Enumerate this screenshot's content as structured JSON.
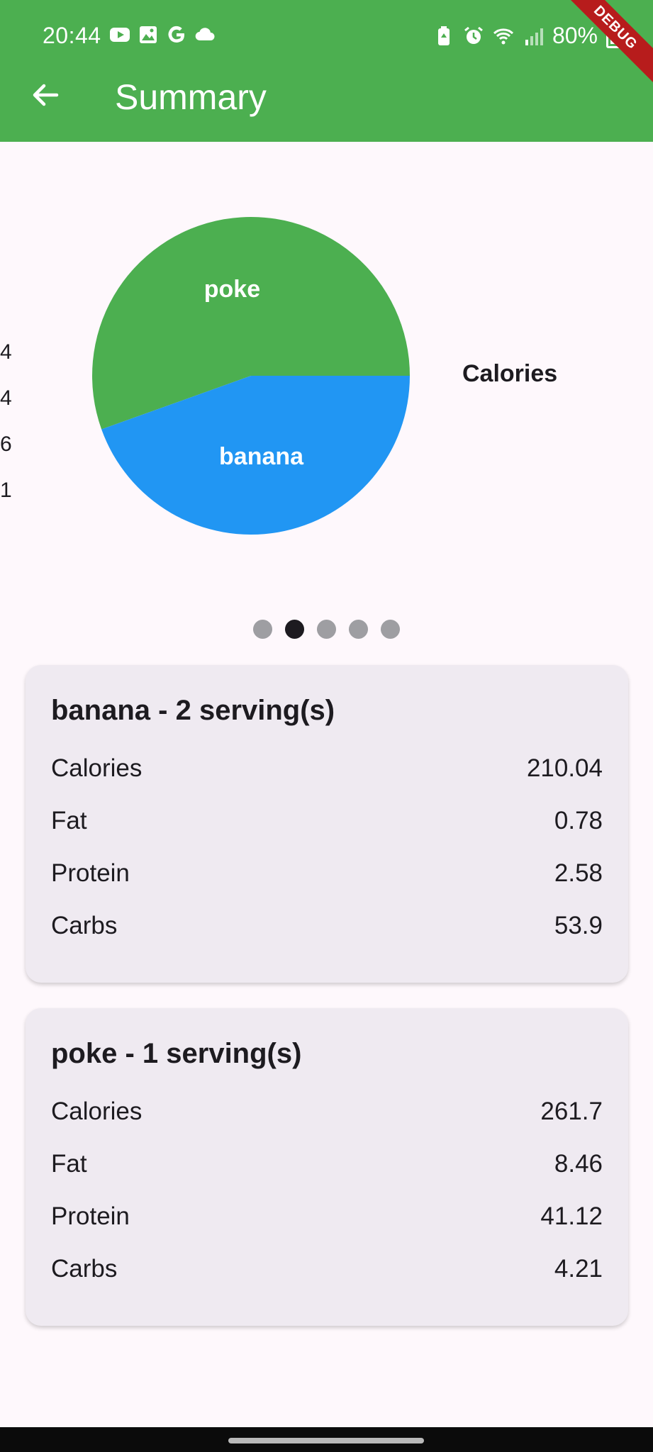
{
  "status_bar": {
    "time": "20:44",
    "battery": "80%",
    "left_icons": [
      "youtube-icon",
      "gallery-icon",
      "google-icon",
      "cloud-icon"
    ],
    "right_icons": [
      "battery-saver-icon",
      "alarm-icon",
      "wifi-icon",
      "signal-icon"
    ]
  },
  "app_bar": {
    "title": "Summary",
    "back_icon": "arrow-back-icon",
    "debug_label": "DEBUG",
    "color": "#4caf50"
  },
  "chart_data": {
    "type": "pie",
    "legend_label": "Calories",
    "slices": [
      {
        "label": "poke",
        "value": 261.7,
        "color": "#4caf50"
      },
      {
        "label": "banana",
        "value": 210.04,
        "color": "#2196f3"
      }
    ],
    "axis_numbers": [
      "4",
      "4",
      "6",
      "1"
    ]
  },
  "pager": {
    "count": 5,
    "active": 1
  },
  "cards": [
    {
      "title": "banana - 2 serving(s)",
      "rows": [
        {
          "label": "Calories",
          "value": "210.04"
        },
        {
          "label": "Fat",
          "value": "0.78"
        },
        {
          "label": "Protein",
          "value": "2.58"
        },
        {
          "label": "Carbs",
          "value": "53.9"
        }
      ]
    },
    {
      "title": "poke - 1 serving(s)",
      "rows": [
        {
          "label": "Calories",
          "value": "261.7"
        },
        {
          "label": "Fat",
          "value": "8.46"
        },
        {
          "label": "Protein",
          "value": "41.12"
        },
        {
          "label": "Carbs",
          "value": "4.21"
        }
      ]
    }
  ]
}
